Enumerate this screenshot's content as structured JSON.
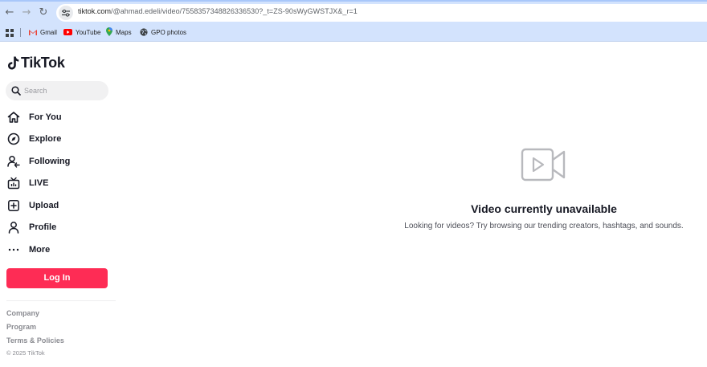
{
  "browser": {
    "url_host": "tiktok.com",
    "url_path": "/@ahmad.edeli/video/7558357348826336530?_t=ZS-90sWyGWSTJX&_r=1",
    "bookmarks": [
      {
        "label": "Gmail",
        "icon": "gmail-icon"
      },
      {
        "label": "YouTube",
        "icon": "youtube-icon"
      },
      {
        "label": "Maps",
        "icon": "maps-icon"
      },
      {
        "label": "GPO photos",
        "icon": "globe-icon"
      }
    ]
  },
  "sidebar": {
    "logo_text": "TikTok",
    "search_placeholder": "Search",
    "nav": [
      {
        "label": "For You",
        "icon": "home-icon"
      },
      {
        "label": "Explore",
        "icon": "compass-icon"
      },
      {
        "label": "Following",
        "icon": "following-icon"
      },
      {
        "label": "LIVE",
        "icon": "live-tv-icon"
      },
      {
        "label": "Upload",
        "icon": "upload-plus-icon"
      },
      {
        "label": "Profile",
        "icon": "profile-icon"
      },
      {
        "label": "More",
        "icon": "more-dots-icon"
      }
    ],
    "login_label": "Log In",
    "footer": {
      "company": "Company",
      "program": "Program",
      "terms": "Terms & Policies",
      "copyright": "© 2025 TikTok"
    }
  },
  "main": {
    "title": "Video currently unavailable",
    "description": "Looking for videos? Try browsing our trending creators, hashtags, and sounds."
  },
  "colors": {
    "brand_red": "#fe2c55",
    "text_dark": "#161823",
    "chrome_blue": "#d3e3fd"
  }
}
